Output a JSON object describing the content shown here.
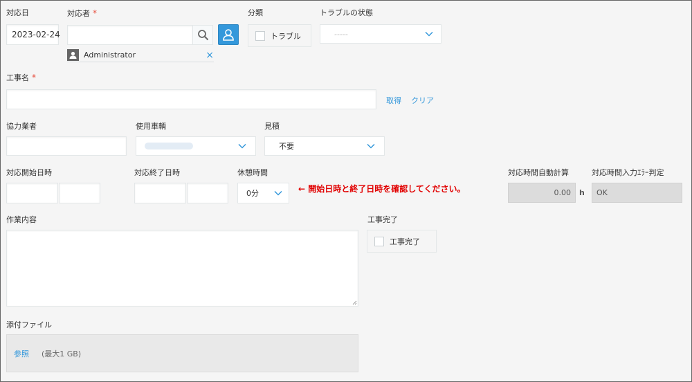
{
  "fields": {
    "date": {
      "label": "対応日",
      "value": "2023-02-24"
    },
    "responder": {
      "label": "対応者",
      "required_mark": "*",
      "input_value": "",
      "selected_user": "Administrator",
      "remove_glyph": "×"
    },
    "category": {
      "label": "分類",
      "option_label": "トラブル"
    },
    "trouble_status": {
      "label": "トラブルの状態",
      "value": "-----"
    },
    "job_name": {
      "label": "工事名",
      "required_mark": "*",
      "value": "",
      "fetch_link": "取得",
      "clear_link": "クリア"
    },
    "partner": {
      "label": "協力業者",
      "value": ""
    },
    "vehicle": {
      "label": "使用車輌",
      "value": ""
    },
    "estimate": {
      "label": "見積",
      "value": "不要"
    },
    "start_datetime": {
      "label": "対応開始日時",
      "date": "",
      "time": ""
    },
    "end_datetime": {
      "label": "対応終了日時",
      "date": "",
      "time": ""
    },
    "break_time": {
      "label": "休憩時間",
      "value": "0分"
    },
    "notice": "← 開始日時と終了日時を確認してください。",
    "auto_hours": {
      "label": "対応時間自動計算",
      "value": "0.00",
      "unit": "h"
    },
    "input_check": {
      "label": "対応時間入力ｴﾗｰ判定",
      "value": "OK"
    },
    "work_content": {
      "label": "作業内容",
      "value": ""
    },
    "job_complete": {
      "label": "工事完了",
      "option_label": "工事完了"
    },
    "attachment": {
      "label": "添付ファイル",
      "browse": "参照",
      "limit": "(最大1 GB)"
    }
  },
  "icons": {
    "search": "search-icon",
    "user": "user-icon",
    "chevron": "chevron-down-icon"
  },
  "colors": {
    "accent": "#3498db",
    "required": "#e74c3c",
    "notice": "#e10000"
  }
}
